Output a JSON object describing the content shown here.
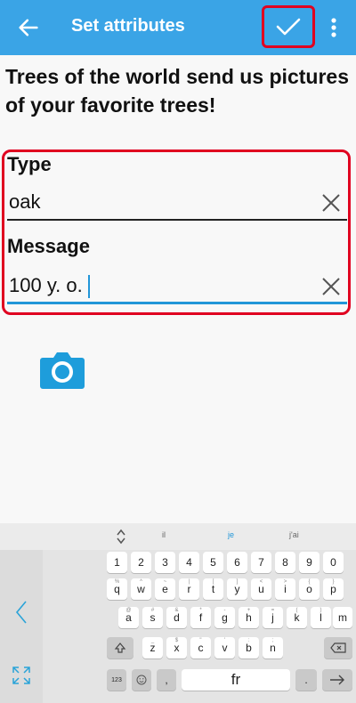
{
  "app_bar": {
    "title": "Set attributes",
    "back_icon": "arrow-left-icon",
    "confirm_icon": "check-icon",
    "menu_icon": "more-vertical-icon",
    "color": "#3aa4e6"
  },
  "heading": "Trees of the world send us pictures of your favorite trees!",
  "form": {
    "type_label": "Type",
    "type_value": "oak",
    "message_label": "Message",
    "message_value": "100 y. o."
  },
  "camera_icon": "camera-icon",
  "keyboard": {
    "suggestions": [
      "il",
      "je",
      "j'ai"
    ],
    "row1": [
      "1",
      "2",
      "3",
      "4",
      "5",
      "6",
      "7",
      "8",
      "9",
      "0"
    ],
    "row2": [
      "q",
      "w",
      "e",
      "r",
      "t",
      "y",
      "u",
      "i",
      "o",
      "p"
    ],
    "row3": [
      "a",
      "s",
      "d",
      "f",
      "g",
      "h",
      "j",
      "k",
      "l",
      "m"
    ],
    "row4": [
      "z",
      "x",
      "c",
      "v",
      "b",
      "n"
    ],
    "row1_hints": [
      "",
      "",
      "",
      "",
      "",
      "",
      "",
      "",
      "",
      ""
    ],
    "row2_hints": [
      "%",
      "^",
      "~",
      "|",
      "[",
      "]",
      "<",
      ">",
      "{",
      "}"
    ],
    "row3_hints": [
      "@",
      "#",
      "&",
      "*",
      "-",
      "+",
      "=",
      "(",
      ")",
      ""
    ],
    "row4_hints": [
      "_",
      "$",
      "\"",
      "'",
      ":",
      ";"
    ],
    "sym_key": "123",
    "space_label": "fr",
    "lang_key": ","
  }
}
